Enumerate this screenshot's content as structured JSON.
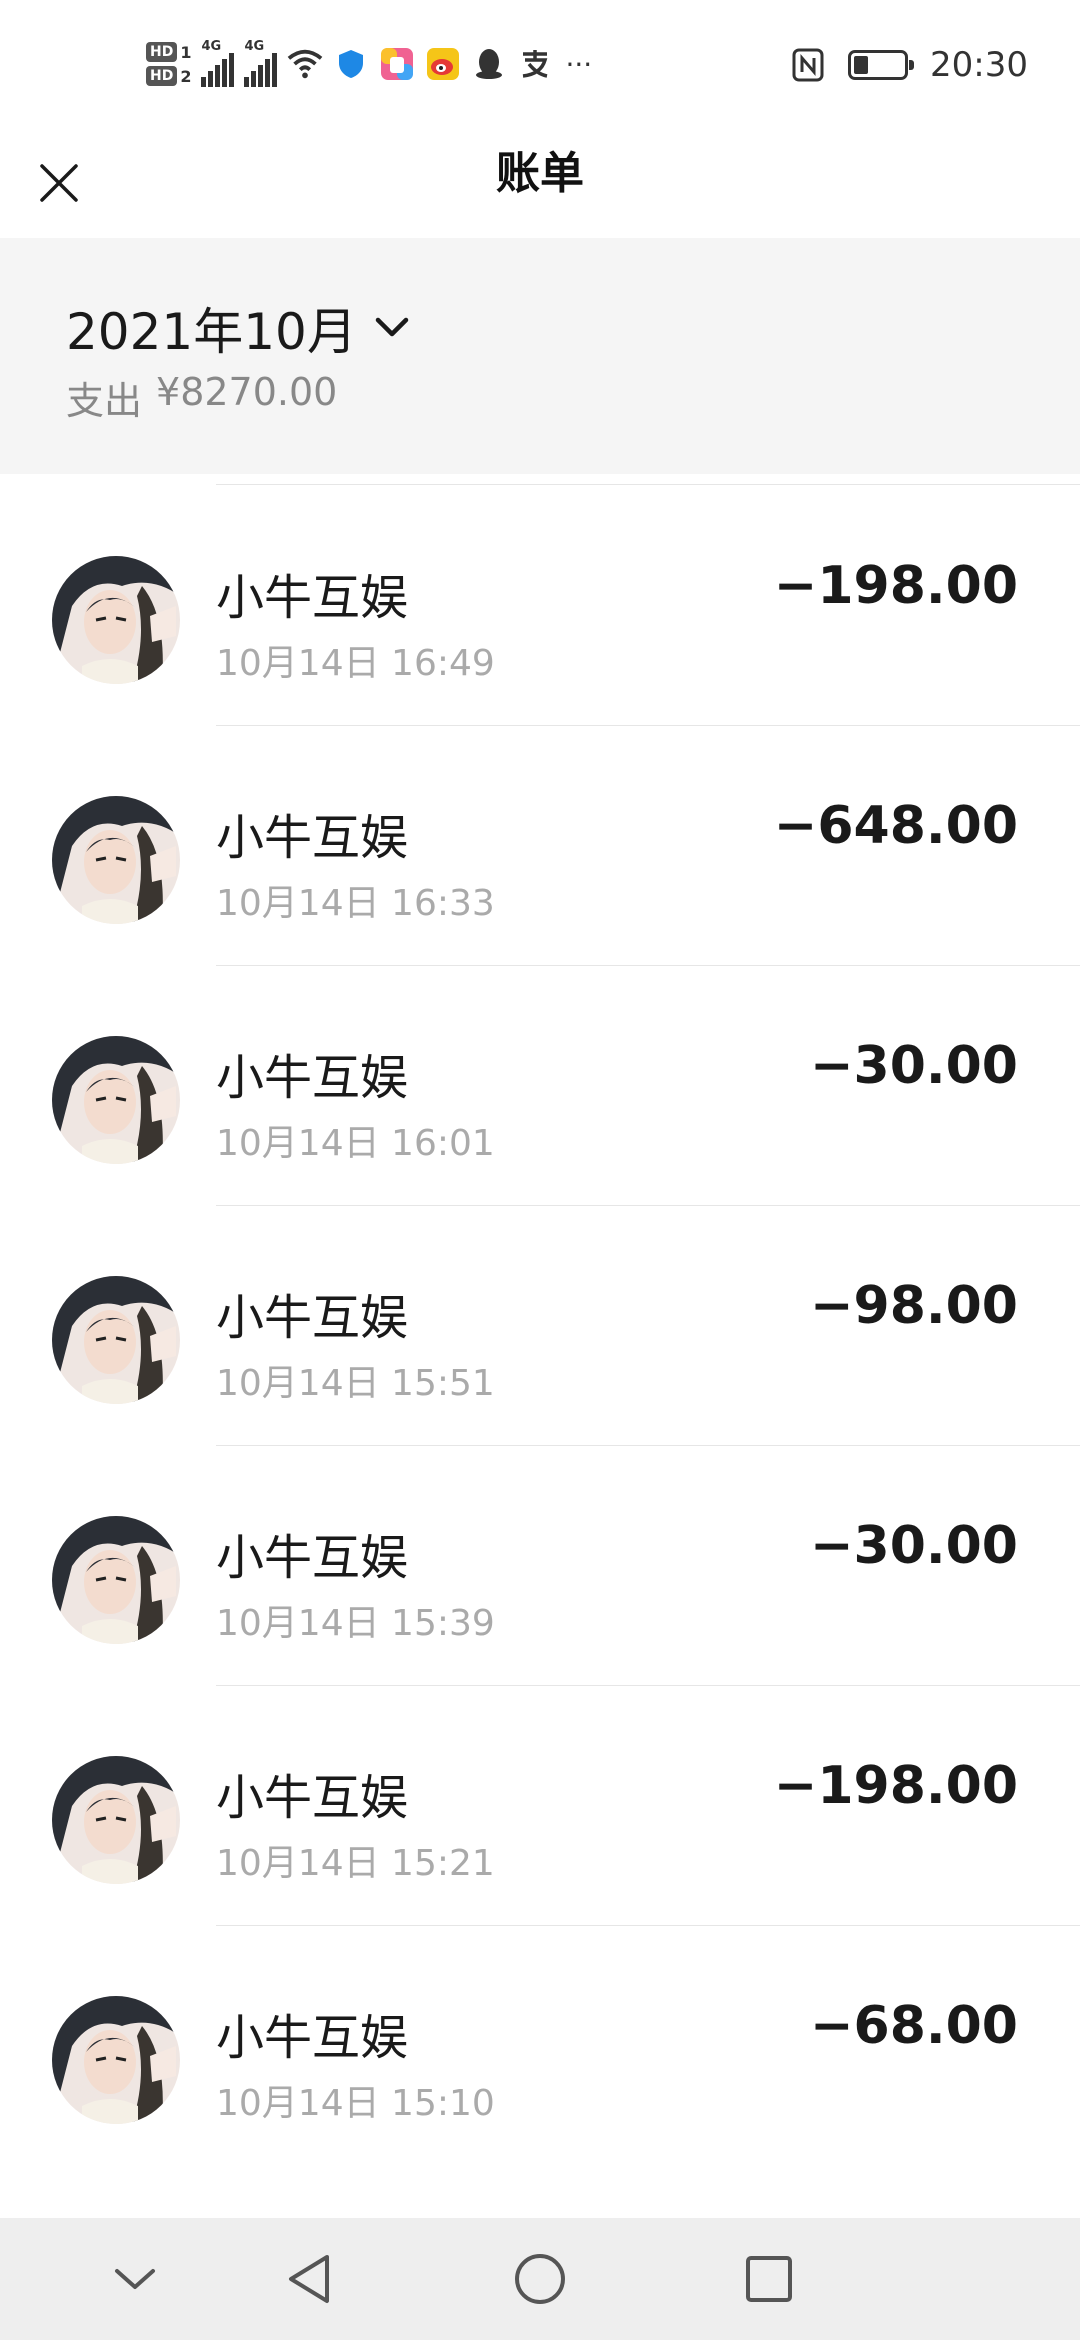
{
  "status_bar": {
    "hd1": "HD",
    "hd1_num": "1",
    "hd2": "HD",
    "hd2_num": "2",
    "net1": "4G",
    "net2": "4G",
    "more": "···",
    "time": "20:30",
    "battery_level": 0.3
  },
  "header": {
    "title": "账单",
    "close_icon": "close-icon"
  },
  "summary": {
    "month": "2021年10月",
    "expense_label": "支出",
    "expense_value": "¥8270.00"
  },
  "transactions": [
    {
      "name": "小牛互娱",
      "time": "10月14日 16:49",
      "amount": "−198.00"
    },
    {
      "name": "小牛互娱",
      "time": "10月14日 16:33",
      "amount": "−648.00"
    },
    {
      "name": "小牛互娱",
      "time": "10月14日 16:01",
      "amount": "−30.00"
    },
    {
      "name": "小牛互娱",
      "time": "10月14日 15:51",
      "amount": "−98.00"
    },
    {
      "name": "小牛互娱",
      "time": "10月14日 15:39",
      "amount": "−30.00"
    },
    {
      "name": "小牛互娱",
      "time": "10月14日 15:21",
      "amount": "−198.00"
    },
    {
      "name": "小牛互娱",
      "time": "10月14日 15:10",
      "amount": "−68.00"
    }
  ],
  "nav_bar": {
    "icons": [
      "chevron-down-icon",
      "back-triangle-icon",
      "home-circle-icon",
      "recents-square-icon"
    ]
  }
}
